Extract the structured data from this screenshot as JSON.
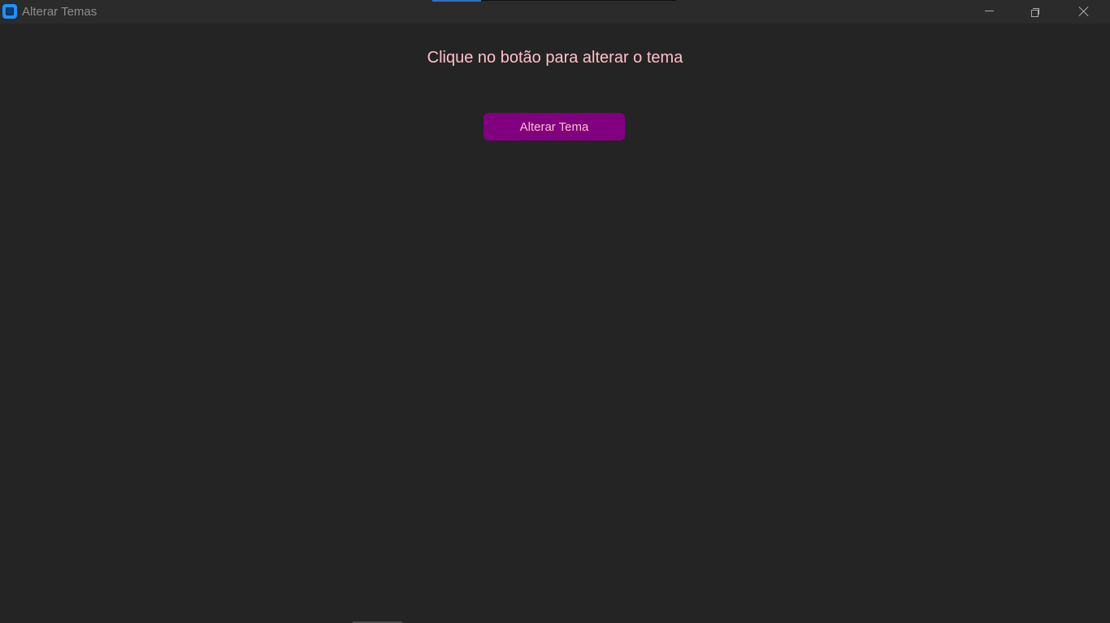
{
  "window": {
    "title": "Alterar Temas",
    "icon": "app-window-icon",
    "controls": {
      "minimize_icon": "minimize-icon",
      "maximize_icon": "restore-icon",
      "close_icon": "close-icon"
    }
  },
  "main": {
    "prompt": "Clique no botão para alterar o tema",
    "button_label": "Alterar Tema"
  },
  "colors": {
    "background": "#242424",
    "titlebar": "#2b2b2b",
    "prompt_text": "#ffc0cb",
    "button_background": "#800080",
    "button_text": "#ffc0cb",
    "app_icon": "#1e90ff"
  }
}
